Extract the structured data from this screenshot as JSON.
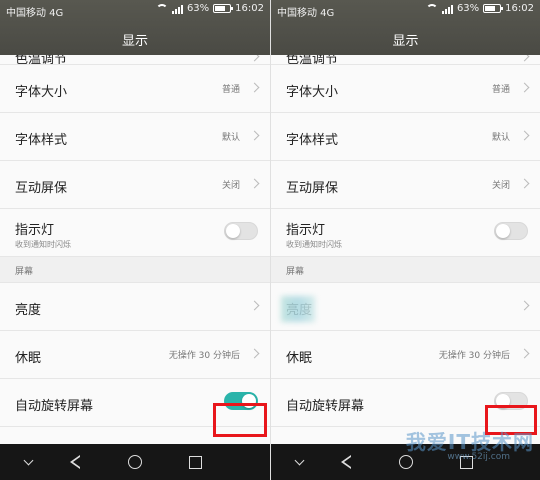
{
  "status_bar": {
    "carrier": "中国移动 4G",
    "battery": "63%",
    "battery_level": 0.63,
    "time": "16:02"
  },
  "header": {
    "title": "显示"
  },
  "settings": {
    "color_temp": {
      "label": "色温调节"
    },
    "font_size": {
      "label": "字体大小",
      "value": "普通"
    },
    "font_style": {
      "label": "字体样式",
      "value": "默认"
    },
    "interactive_screensaver": {
      "label": "互动屏保",
      "value": "关闭"
    },
    "indicator_light": {
      "label": "指示灯",
      "sublabel": "收到通知时闪烁"
    },
    "section_screen": "屏幕",
    "brightness": {
      "label": "亮度"
    },
    "sleep": {
      "label": "休眠",
      "value": "无操作 30 分钟后"
    },
    "auto_rotate": {
      "label": "自动旋转屏幕"
    }
  },
  "panels": [
    {
      "auto_rotate_on": true
    },
    {
      "auto_rotate_on": false
    }
  ],
  "colors": {
    "accent": "#2ab4aa",
    "highlight": "#e8161b"
  },
  "watermark": {
    "text": "我爱IT技术网",
    "url": "www.52ij.com"
  }
}
